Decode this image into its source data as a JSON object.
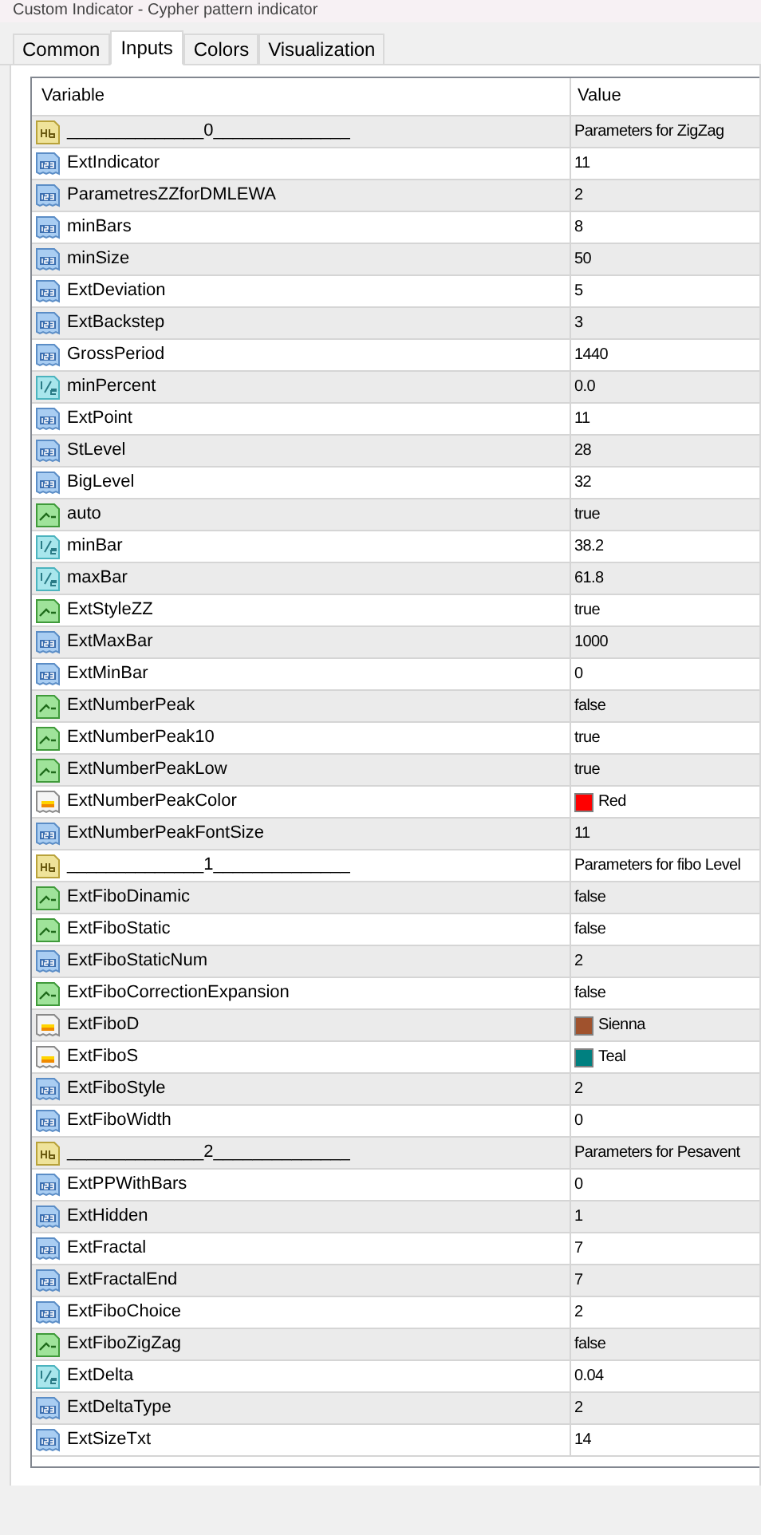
{
  "window": {
    "title": "Custom Indicator - Cypher pattern indicator"
  },
  "tabs": [
    {
      "label": "Common",
      "selected": false
    },
    {
      "label": "Inputs",
      "selected": true
    },
    {
      "label": "Colors",
      "selected": false
    },
    {
      "label": "Visualization",
      "selected": false
    }
  ],
  "table": {
    "columns": [
      "Variable",
      "Value"
    ],
    "rows": [
      {
        "kind": "string",
        "variable": "______________0______________",
        "value": "Parameters for ZigZag"
      },
      {
        "kind": "int",
        "variable": "ExtIndicator",
        "value": "11"
      },
      {
        "kind": "int",
        "variable": "ParametresZZforDMLEWA",
        "value": "2"
      },
      {
        "kind": "int",
        "variable": "minBars",
        "value": "8"
      },
      {
        "kind": "int",
        "variable": "minSize",
        "value": "50"
      },
      {
        "kind": "int",
        "variable": "ExtDeviation",
        "value": "5"
      },
      {
        "kind": "int",
        "variable": "ExtBackstep",
        "value": "3"
      },
      {
        "kind": "int",
        "variable": "GrossPeriod",
        "value": "1440"
      },
      {
        "kind": "double",
        "variable": "minPercent",
        "value": "0.0"
      },
      {
        "kind": "int",
        "variable": "ExtPoint",
        "value": "11"
      },
      {
        "kind": "int",
        "variable": "StLevel",
        "value": "28"
      },
      {
        "kind": "int",
        "variable": "BigLevel",
        "value": "32"
      },
      {
        "kind": "bool",
        "variable": "auto",
        "value": "true"
      },
      {
        "kind": "double",
        "variable": "minBar",
        "value": "38.2"
      },
      {
        "kind": "double",
        "variable": "maxBar",
        "value": "61.8"
      },
      {
        "kind": "bool",
        "variable": "ExtStyleZZ",
        "value": "true"
      },
      {
        "kind": "int",
        "variable": "ExtMaxBar",
        "value": "1000"
      },
      {
        "kind": "int",
        "variable": "ExtMinBar",
        "value": "0"
      },
      {
        "kind": "bool",
        "variable": "ExtNumberPeak",
        "value": "false"
      },
      {
        "kind": "bool",
        "variable": "ExtNumberPeak10",
        "value": "true"
      },
      {
        "kind": "bool",
        "variable": "ExtNumberPeakLow",
        "value": "true"
      },
      {
        "kind": "color",
        "variable": "ExtNumberPeakColor",
        "value": "Red",
        "color": "#ff0000"
      },
      {
        "kind": "int",
        "variable": "ExtNumberPeakFontSize",
        "value": "11"
      },
      {
        "kind": "string",
        "variable": "______________1______________",
        "value": "Parameters for fibo Level"
      },
      {
        "kind": "bool",
        "variable": "ExtFiboDinamic",
        "value": "false"
      },
      {
        "kind": "bool",
        "variable": "ExtFiboStatic",
        "value": "false"
      },
      {
        "kind": "int",
        "variable": "ExtFiboStaticNum",
        "value": "2"
      },
      {
        "kind": "bool",
        "variable": "ExtFiboCorrectionExpansion",
        "value": "false"
      },
      {
        "kind": "color",
        "variable": "ExtFiboD",
        "value": "Sienna",
        "color": "#a0522d"
      },
      {
        "kind": "color",
        "variable": "ExtFiboS",
        "value": "Teal",
        "color": "#008080"
      },
      {
        "kind": "int",
        "variable": "ExtFiboStyle",
        "value": "2"
      },
      {
        "kind": "int",
        "variable": "ExtFiboWidth",
        "value": "0"
      },
      {
        "kind": "string",
        "variable": "______________2______________",
        "value": "Parameters for Pesavent"
      },
      {
        "kind": "int",
        "variable": "ExtPPWithBars",
        "value": "0"
      },
      {
        "kind": "int",
        "variable": "ExtHidden",
        "value": "1"
      },
      {
        "kind": "int",
        "variable": "ExtFractal",
        "value": "7"
      },
      {
        "kind": "int",
        "variable": "ExtFractalEnd",
        "value": "7"
      },
      {
        "kind": "int",
        "variable": "ExtFiboChoice",
        "value": "2"
      },
      {
        "kind": "bool",
        "variable": "ExtFiboZigZag",
        "value": "false"
      },
      {
        "kind": "double",
        "variable": "ExtDelta",
        "value": "0.04"
      },
      {
        "kind": "int",
        "variable": "ExtDeltaType",
        "value": "2"
      },
      {
        "kind": "int",
        "variable": "ExtSizeTxt",
        "value": "14"
      }
    ]
  }
}
